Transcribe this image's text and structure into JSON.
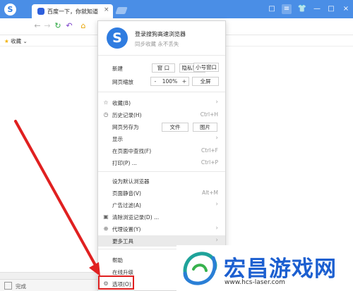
{
  "tab": {
    "title": "百度一下，你就知道",
    "close": "×"
  },
  "window_buttons": [
    "□",
    "≡",
    "👕",
    "—",
    "□",
    "×"
  ],
  "nav": {
    "back": "←",
    "forward": "→",
    "reload": "↻",
    "undo": "↶",
    "home": "⌂"
  },
  "bookmarks": {
    "label": "收藏",
    "chevron": "⌄"
  },
  "status": {
    "text": "完成"
  },
  "menu": {
    "login_title": "登录搜狗高速浏览器",
    "login_subtitle": "同步收藏 永不丢失",
    "new_label": "新建",
    "new_buttons": [
      "窗 口",
      "隐私窗口",
      "小号窗口"
    ],
    "zoom_label": "网页缩放",
    "zoom_minus": "-",
    "zoom_value": "100%",
    "zoom_plus": "+",
    "fullscreen": "全屏",
    "items": [
      {
        "icon": "☆",
        "label": "收藏(B)",
        "shortcut": "",
        "arrow": "›"
      },
      {
        "icon": "◷",
        "label": "历史记录(H)",
        "shortcut": "Ctrl+H",
        "arrow": ""
      },
      {
        "icon": "",
        "label": "网页另存为",
        "shortcut": "",
        "arrow": ""
      },
      {
        "icon": "",
        "label": "显示",
        "shortcut": "",
        "arrow": "›"
      },
      {
        "icon": "",
        "label": "在页面中查找(F)",
        "shortcut": "Ctrl+F",
        "arrow": ""
      },
      {
        "icon": "",
        "label": "打印(P) ...",
        "shortcut": "Ctrl+P",
        "arrow": ""
      },
      {
        "icon": "",
        "label": "设为默认浏览器",
        "shortcut": "",
        "arrow": ""
      },
      {
        "icon": "",
        "label": "页面静音(V)",
        "shortcut": "Alt+M",
        "arrow": ""
      },
      {
        "icon": "",
        "label": "广告过滤(A)",
        "shortcut": "",
        "arrow": "›"
      },
      {
        "icon": "▣",
        "label": "清除浏览记录(D) ...",
        "shortcut": "",
        "arrow": ""
      },
      {
        "icon": "⊕",
        "label": "代理设置(Y)",
        "shortcut": "",
        "arrow": "›"
      },
      {
        "icon": "",
        "label": "更多工具",
        "shortcut": "",
        "arrow": "›"
      },
      {
        "icon": "",
        "label": "帮助",
        "shortcut": "",
        "arrow": ""
      },
      {
        "icon": "",
        "label": "在线升级",
        "shortcut": "",
        "arrow": ""
      },
      {
        "icon": "⚙",
        "label": "选项(O)",
        "shortcut": "",
        "arrow": ""
      }
    ],
    "save_as_buttons": [
      "文件",
      "图片"
    ]
  },
  "watermark": {
    "title": "宏昌游戏网",
    "url": "www.hcs-laser.com"
  },
  "colors": {
    "titlebar": "#4a8ee6",
    "arrow": "#e02020",
    "watermark": "#1c5fd0"
  }
}
